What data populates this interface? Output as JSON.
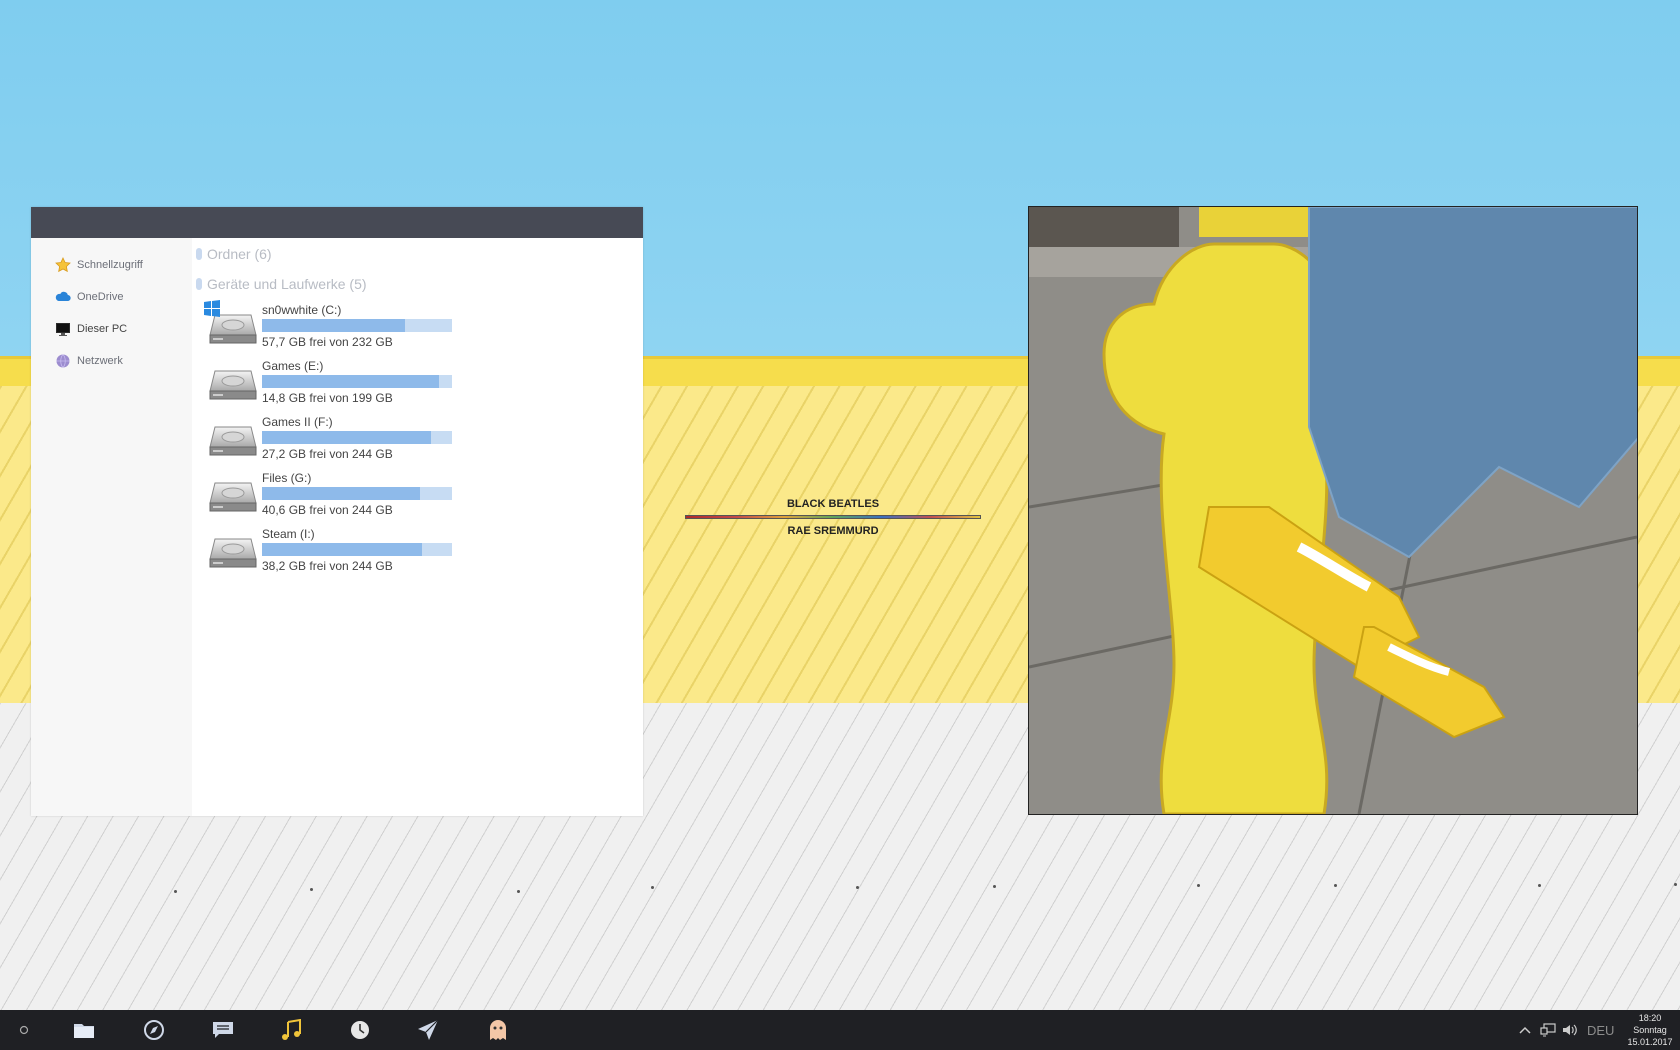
{
  "explorer": {
    "sidebar": [
      {
        "label": "Schnellzugriff",
        "icon": "star-icon"
      },
      {
        "label": "OneDrive",
        "icon": "cloud-icon"
      },
      {
        "label": "Dieser PC",
        "icon": "monitor-icon"
      },
      {
        "label": "Netzwerk",
        "icon": "network-globe-icon"
      }
    ],
    "groups": {
      "folders": "Ordner (6)",
      "drives": "Geräte und Laufwerke (5)"
    },
    "drives": [
      {
        "name": "sn0wwhite (C:)",
        "free": "57,7 GB frei von 232 GB",
        "used_fraction": 0.75,
        "system": true
      },
      {
        "name": "Games (E:)",
        "free": "14,8 GB frei von 199 GB",
        "used_fraction": 0.93
      },
      {
        "name": "Games II (F:)",
        "free": "27,2 GB frei von 244 GB",
        "used_fraction": 0.89
      },
      {
        "name": "Files (G:)",
        "free": "40,6 GB frei von 244 GB",
        "used_fraction": 0.83
      },
      {
        "name": "Steam (I:)",
        "free": "38,2 GB frei von 244 GB",
        "used_fraction": 0.84
      }
    ]
  },
  "music": {
    "title": "BLACK BEATLES",
    "artist": "RAE SREMMURD"
  },
  "taskbar": {
    "icons": [
      "search-circle-icon",
      "folder-icon",
      "compass-icon",
      "chat-icon",
      "music-note-icon",
      "clock-icon",
      "send-icon",
      "ghost-icon"
    ],
    "tray": {
      "language": "DEU",
      "time": "18:20",
      "day": "Sonntag",
      "date": "15.01.2017"
    }
  },
  "colors": {
    "titlebar": "#474a55",
    "drive_bar_fill": "#8ebaea",
    "drive_bar_bg": "#c7dcf3",
    "taskbar": "#1f2024"
  }
}
